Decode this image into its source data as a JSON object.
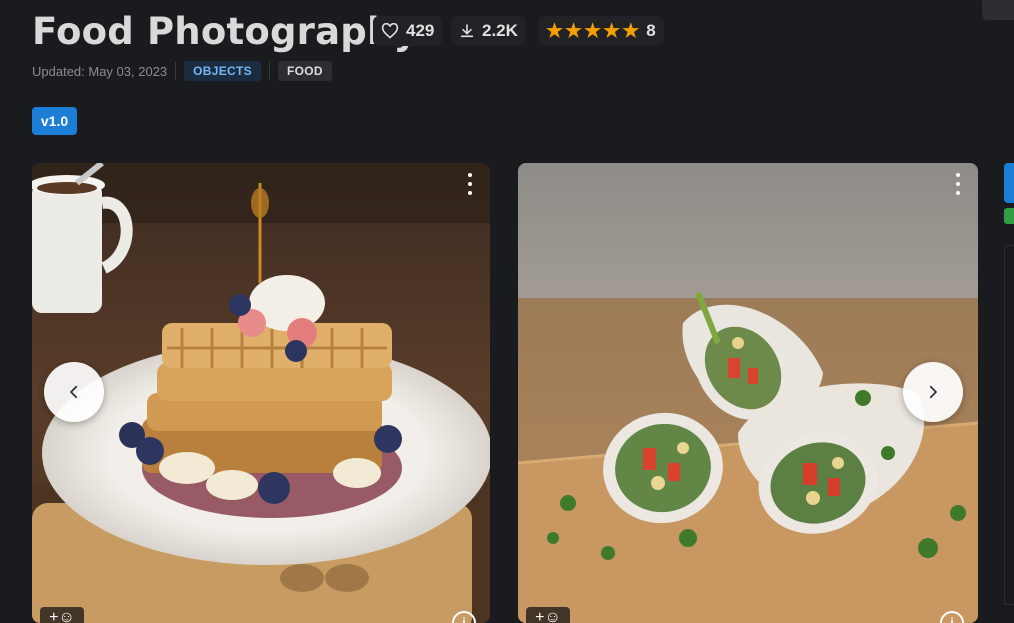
{
  "model": {
    "title": "Food Photography",
    "likes": "429",
    "downloads": "2.2K",
    "rating_count": "8",
    "stars": 5,
    "updated": "Updated: May 03, 2023",
    "tags": [
      "OBJECTS",
      "FOOD"
    ],
    "version": "v1.0"
  },
  "icons": {
    "like": "heart-icon",
    "download": "download-icon",
    "rating": "star-icon",
    "menu": "more-vertical-icon",
    "prev": "chevron-left-icon",
    "next": "chevron-right-icon",
    "reaction": "add-reaction-icon",
    "info": "info-icon"
  },
  "gallery": {
    "images": [
      {
        "subject": "waffles"
      },
      {
        "subject": "spring-rolls"
      }
    ]
  },
  "colors": {
    "background": "#1a1b1e",
    "accent": "#1c7ed6",
    "star": "#f59f00",
    "tag_objects_bg": "#1c2c40",
    "tag_objects_text": "#74b6f5"
  }
}
